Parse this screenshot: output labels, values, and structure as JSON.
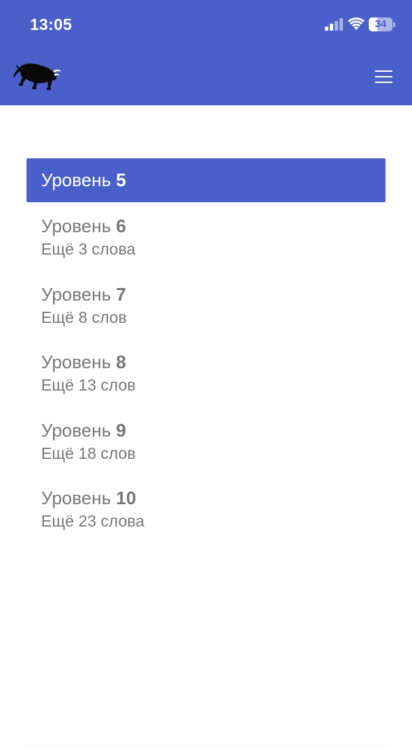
{
  "status_bar": {
    "time": "13:05",
    "battery_level": "34",
    "icons": [
      "signal-icon",
      "wifi-icon",
      "battery-icon"
    ]
  },
  "header": {
    "logo": "bull-logo-icon",
    "menu_icon": "hamburger-menu-icon",
    "accent_color": "#4A5FC9"
  },
  "levels": [
    {
      "label": "Уровень",
      "number": "5",
      "remaining": "",
      "active": true
    },
    {
      "label": "Уровень",
      "number": "6",
      "remaining": "Ещё 3 слова",
      "active": false
    },
    {
      "label": "Уровень",
      "number": "7",
      "remaining": "Ещё 8 слов",
      "active": false
    },
    {
      "label": "Уровень",
      "number": "8",
      "remaining": "Ещё 13 слов",
      "active": false
    },
    {
      "label": "Уровень",
      "number": "9",
      "remaining": "Ещё 18 слов",
      "active": false
    },
    {
      "label": "Уровень",
      "number": "10",
      "remaining": "Ещё 23 слова",
      "active": false
    }
  ]
}
